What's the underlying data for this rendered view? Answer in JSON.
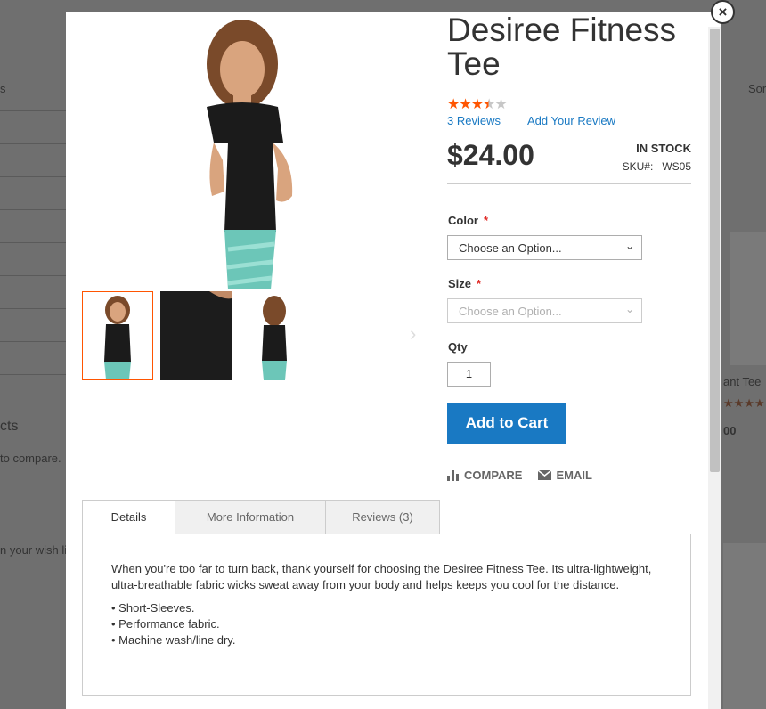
{
  "background": {
    "texts": [
      "s",
      "cts",
      "to compare.",
      "n your wish li",
      "Sor",
      "ant Tee",
      "00"
    ]
  },
  "product": {
    "title": "Desiree Fitness Tee",
    "rating_stars": 3.5,
    "reviews_link": "3 Reviews",
    "add_review_link": "Add Your Review",
    "price": "$24.00",
    "stock": "IN STOCK",
    "sku_label": "SKU#:",
    "sku_value": "WS05"
  },
  "options": {
    "color_label": "Color",
    "color_placeholder": "Choose an Option...",
    "size_label": "Size",
    "size_placeholder": "Choose an Option...",
    "required_mark": "*",
    "qty_label": "Qty",
    "qty_value": "1"
  },
  "buttons": {
    "add_to_cart": "Add to Cart",
    "compare": "COMPARE",
    "email": "EMAIL",
    "close": "×"
  },
  "tabs": [
    {
      "label": "Details",
      "active": true
    },
    {
      "label": "More Information",
      "active": false
    },
    {
      "label": "Reviews (3)",
      "active": false
    }
  ],
  "details": {
    "description": "When you're too far to turn back, thank yourself for choosing the Desiree Fitness Tee. Its ultra-lightweight, ultra-breathable fabric wicks sweat away from your body and helps keeps you cool for the distance.",
    "bullets": [
      "• Short-Sleeves.",
      "• Performance fabric.",
      "• Machine wash/line dry."
    ]
  },
  "colors": {
    "accent": "#1979c3",
    "star": "#ff5501",
    "active_thumb_border": "#ff5501"
  }
}
